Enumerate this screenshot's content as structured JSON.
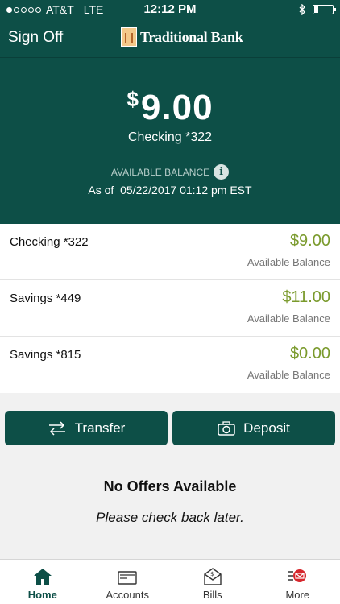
{
  "status_bar": {
    "carrier": "AT&T",
    "network": "LTE",
    "time": "12:12 PM"
  },
  "nav": {
    "sign_off": "Sign Off",
    "brand": "Traditional Bank"
  },
  "hero": {
    "currency": "$",
    "amount": "9.00",
    "account": "Checking *322",
    "available_label": "AVAILABLE BALANCE",
    "as_of_label": "As of",
    "as_of_value": "05/22/2017 01:12 pm EST"
  },
  "accounts": [
    {
      "name": "Checking *322",
      "balance": "$9.00",
      "balance_label": "Available Balance"
    },
    {
      "name": "Savings *449",
      "balance": "$11.00",
      "balance_label": "Available Balance"
    },
    {
      "name": "Savings *815",
      "balance": "$0.00",
      "balance_label": "Available Balance"
    }
  ],
  "actions": {
    "transfer": "Transfer",
    "deposit": "Deposit"
  },
  "offers": {
    "title": "No Offers Available",
    "subtitle": "Please check back later."
  },
  "tabs": [
    {
      "label": "Home",
      "icon": "home-icon"
    },
    {
      "label": "Accounts",
      "icon": "wallet-icon"
    },
    {
      "label": "Bills",
      "icon": "bill-envelope-icon"
    },
    {
      "label": "More",
      "icon": "more-menu-icon"
    }
  ],
  "colors": {
    "primary": "#0d4f47",
    "balance_green": "#7a9a2c",
    "badge_red": "#d6262c"
  }
}
